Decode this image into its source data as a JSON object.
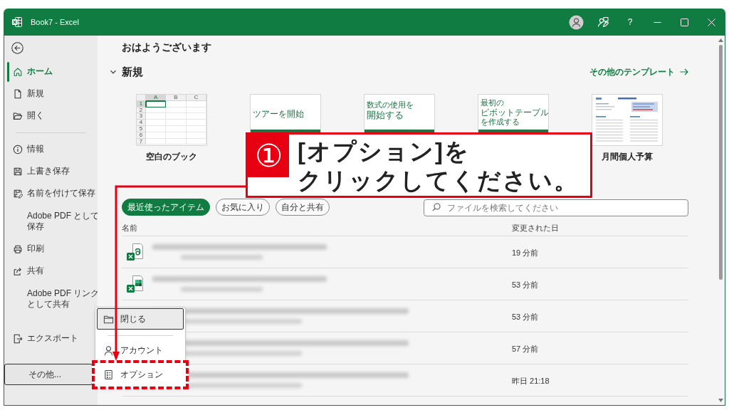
{
  "window": {
    "title": "Book7 - Excel",
    "help": "?"
  },
  "sidebar": {
    "groups": [
      [
        {
          "kind": "home",
          "label": "ホーム",
          "selected": true
        },
        {
          "kind": "new",
          "label": "新規",
          "selected": false
        },
        {
          "kind": "open",
          "label": "開く",
          "selected": false
        }
      ],
      [
        {
          "kind": "info",
          "label": "情報",
          "selected": false
        },
        {
          "kind": "save",
          "label": "上書き保存",
          "selected": false
        },
        {
          "kind": "saveas",
          "label": "名前を付けて保存",
          "selected": false
        },
        {
          "kind": "plain",
          "lines": [
            "Adobe PDF として",
            "保存"
          ],
          "selected": false
        },
        {
          "kind": "print",
          "label": "印刷",
          "selected": false
        },
        {
          "kind": "share",
          "label": "共有",
          "selected": false
        },
        {
          "kind": "plain",
          "lines": [
            "Adobe PDF リンク",
            "として共有"
          ],
          "selected": false
        }
      ]
    ],
    "bottom_items": [
      {
        "kind": "export",
        "label": "エクスポート",
        "selected": false
      }
    ],
    "more_button": {
      "label": "その他...",
      "expanded": true
    }
  },
  "more_menu": {
    "groups": [
      [
        {
          "kind": "close",
          "label": "閉じる",
          "focused": true,
          "highlighted": false
        }
      ],
      [
        {
          "kind": "account",
          "label": "アカウント",
          "focused": false,
          "highlighted": false
        },
        {
          "kind": "options",
          "label": "オプション",
          "focused": false,
          "highlighted": true
        }
      ]
    ]
  },
  "greeting": "おはようございます",
  "new_section": {
    "title": "新規",
    "expanded": true,
    "more_link": "その他のテンプレート",
    "templates": [
      {
        "kind": "blank",
        "label": "空白のブック",
        "columns": [
          {
            "label": "A",
            "selected": true
          },
          {
            "label": "B",
            "selected": false
          },
          {
            "label": "C",
            "selected": false
          }
        ],
        "rows": [
          {
            "label": "1",
            "selected": true
          },
          {
            "label": "2",
            "selected": false
          },
          {
            "label": "3",
            "selected": false
          },
          {
            "label": "4",
            "selected": false
          },
          {
            "label": "5",
            "selected": false
          },
          {
            "label": "6",
            "selected": false
          },
          {
            "label": "7",
            "selected": false
          }
        ]
      },
      {
        "kind": "tour",
        "lines": [
          "ツアーを開始"
        ]
      },
      {
        "kind": "formula",
        "lines": [
          "数式の使用を",
          "開始する"
        ]
      },
      {
        "kind": "pivot",
        "lines": [
          "最初の",
          "ピボットテーブル",
          "を作成する"
        ]
      },
      {
        "kind": "budget",
        "label": "月間個人予算"
      }
    ]
  },
  "filters": [
    {
      "label": "最近使ったアイテム",
      "selected": true
    },
    {
      "label": "お気に入り",
      "selected": false
    },
    {
      "label": "自分と共有",
      "selected": false
    }
  ],
  "search": {
    "placeholder": "ファイルを検索してください"
  },
  "files": {
    "columns": [
      "名前",
      "変更された日"
    ],
    "rows": [
      {
        "kind": "shared",
        "modified": "19 分前"
      },
      {
        "kind": "synced",
        "modified": "53 分前"
      },
      {
        "modified": "53 分前"
      },
      {
        "modified": "57 分前"
      },
      {
        "modified": "昨日 21:18"
      }
    ]
  },
  "annotation": {
    "number": "①",
    "lines": [
      "[オプション]を",
      "クリックしてください。"
    ]
  }
}
